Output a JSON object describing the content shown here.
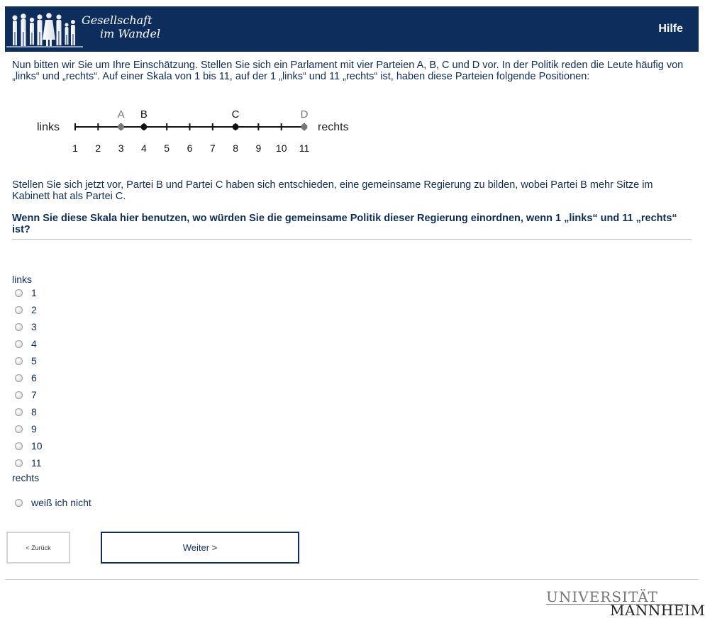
{
  "header": {
    "logo_line1": "Gesellschaft",
    "logo_line2": "im Wandel",
    "help_label": "Hilfe",
    "bg_color": "#0d2d5c"
  },
  "intro_text": "Nun bitten wir Sie um Ihre Einschätzung. Stellen Sie sich ein Parlament mit vier Parteien A, B, C und D vor. In der Politik reden die Leute häufig von „links“ und „rechts“. Auf einer Skala von 1 bis 11, auf der 1 „links“ und 11 „rechts“ ist, haben diese Parteien folgende Positionen:",
  "scale": {
    "left_label": "links",
    "right_label": "rechts",
    "ticks": [
      "1",
      "2",
      "3",
      "4",
      "5",
      "6",
      "7",
      "8",
      "9",
      "10",
      "11"
    ],
    "parties": [
      {
        "name": "A",
        "position": 3,
        "highlighted": false
      },
      {
        "name": "B",
        "position": 4,
        "highlighted": true
      },
      {
        "name": "C",
        "position": 8,
        "highlighted": true
      },
      {
        "name": "D",
        "position": 11,
        "highlighted": false
      }
    ]
  },
  "scenario_text": "Stellen Sie sich jetzt vor, Partei B und Partei C haben sich entschieden, eine gemeinsame Regierung zu bilden, wobei Partei B mehr Sitze im Kabinett hat als Partei C.",
  "question_text": "Wenn Sie diese Skala hier benutzen, wo würden Sie die gemeinsame Politik dieser Regierung einordnen, wenn 1 „links“ und 11 „rechts“ ist?",
  "answer_scale": {
    "top_label": "links",
    "bottom_label": "rechts",
    "options": [
      "1",
      "2",
      "3",
      "4",
      "5",
      "6",
      "7",
      "8",
      "9",
      "10",
      "11"
    ],
    "dont_know": "weiß ich nicht"
  },
  "nav": {
    "back_label": "< Zurück",
    "next_label": "Weiter >"
  },
  "footer": {
    "uni_line1": "UNIVERSITÄT",
    "uni_line2": "MANNHEIM"
  }
}
